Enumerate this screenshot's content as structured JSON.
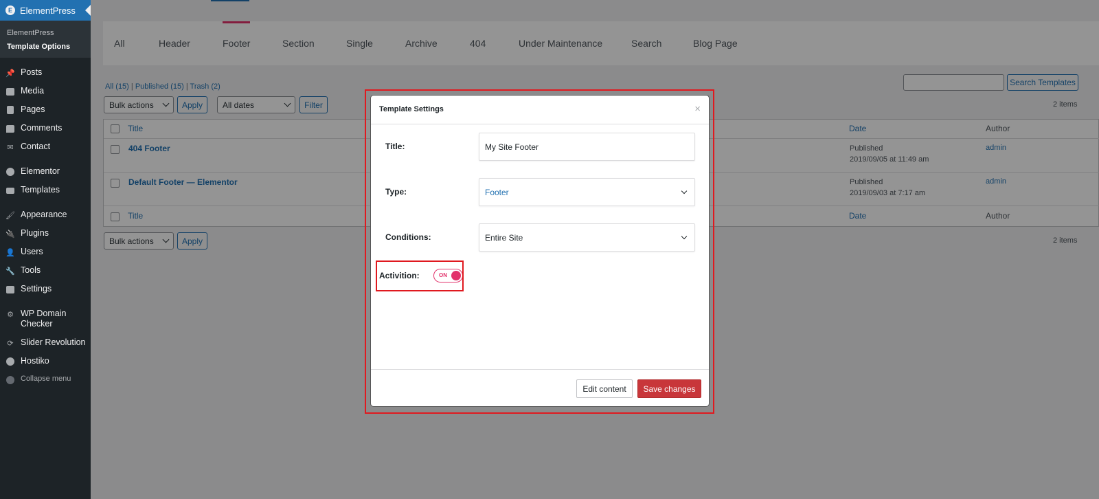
{
  "sidebar": {
    "brand": "ElementPress",
    "brand_icon": "E",
    "submenu": [
      "ElementPress",
      "Template Options"
    ],
    "items_group1": [
      {
        "label": "Posts",
        "icon": "pin-icon"
      },
      {
        "label": "Media",
        "icon": "media-icon"
      },
      {
        "label": "Pages",
        "icon": "pages-icon"
      },
      {
        "label": "Comments",
        "icon": "comments-icon"
      },
      {
        "label": "Contact",
        "icon": "mail-icon"
      }
    ],
    "items_group2": [
      {
        "label": "Elementor",
        "icon": "elementor-icon"
      },
      {
        "label": "Templates",
        "icon": "folder-icon"
      }
    ],
    "items_group3": [
      {
        "label": "Appearance",
        "icon": "brush-icon"
      },
      {
        "label": "Plugins",
        "icon": "plugin-icon"
      },
      {
        "label": "Users",
        "icon": "user-icon"
      },
      {
        "label": "Tools",
        "icon": "wrench-icon"
      },
      {
        "label": "Settings",
        "icon": "settings-icon"
      }
    ],
    "items_group4": [
      {
        "label": "WP Domain Checker",
        "icon": "gear-icon"
      },
      {
        "label": "Slider Revolution",
        "icon": "refresh-icon"
      },
      {
        "label": "Hostiko",
        "icon": "dashboard-icon"
      }
    ],
    "collapse": "Collapse menu"
  },
  "tabs": [
    "All",
    "Header",
    "Footer",
    "Section",
    "Single",
    "Archive",
    "404",
    "Under Maintenance",
    "Search",
    "Blog Page"
  ],
  "active_tab": "Footer",
  "sublinks": {
    "all": "All (15)",
    "published": "Published (15)",
    "trash": "Trash (2)",
    "sep": "|"
  },
  "toolbar": {
    "bulk_actions": "Bulk actions",
    "apply": "Apply",
    "all_dates": "All dates",
    "filter": "Filter",
    "search_button": "Search Templates",
    "items_count": "2 items"
  },
  "table": {
    "headers": {
      "title": "Title",
      "date": "Date",
      "author": "Author"
    },
    "rows": [
      {
        "title": "404 Footer",
        "status": "Published",
        "date": "2019/09/05 at 11:49 am",
        "author": "admin"
      },
      {
        "title": "Default Footer — Elementor",
        "status": "Published",
        "date": "2019/09/03 at 7:17 am",
        "author": "admin"
      }
    ]
  },
  "modal": {
    "title": "Template Settings",
    "close": "×",
    "title_label": "Title:",
    "title_value": "My Site Footer",
    "type_label": "Type:",
    "type_value": "Footer",
    "conditions_label": "Conditions:",
    "conditions_value": "Entire Site",
    "activation_label": "Activition:",
    "toggle_text": "ON",
    "edit_button": "Edit content",
    "save_button": "Save changes"
  },
  "colors": {
    "accent": "#e2336b",
    "wp_blue": "#2271b1",
    "save_red": "#c8363a",
    "highlight": "#e0191f"
  }
}
